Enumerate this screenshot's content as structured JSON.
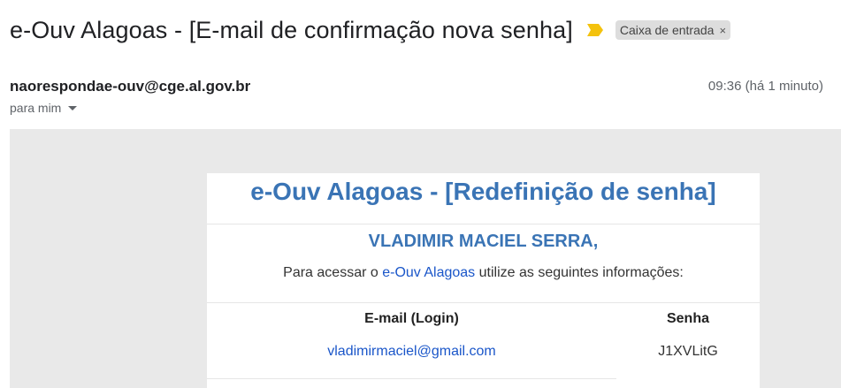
{
  "email": {
    "subject": "e-Ouv Alagoas - [E-mail de confirmação nova senha]",
    "label": "Caixa de entrada",
    "label_close": "×",
    "sender": "naorespondae-ouv@cge.al.gov.br",
    "recipient": "para mim",
    "time": "09:36 (há 1 minuto)",
    "icons": {
      "importance": "importance-marker-icon",
      "recipient_menu": "caret-down-icon",
      "label_remove": "close-icon"
    },
    "colors": {
      "importance": "#f4c20d",
      "heading": "#3a74b5",
      "link": "#1a56c9"
    }
  },
  "body": {
    "title": "e-Ouv Alagoas - [Redefinição de senha]",
    "name": "VLADIMIR MACIEL SERRA,",
    "instr_prefix": "Para acessar o ",
    "instr_link": "e-Ouv Alagoas",
    "instr_suffix": " utilize as seguintes informações:",
    "table": {
      "headers": [
        "E-mail (Login)",
        "Senha"
      ],
      "rows": [
        [
          "vladimirmaciel@gmail.com",
          "J1XVLitG"
        ]
      ]
    }
  }
}
